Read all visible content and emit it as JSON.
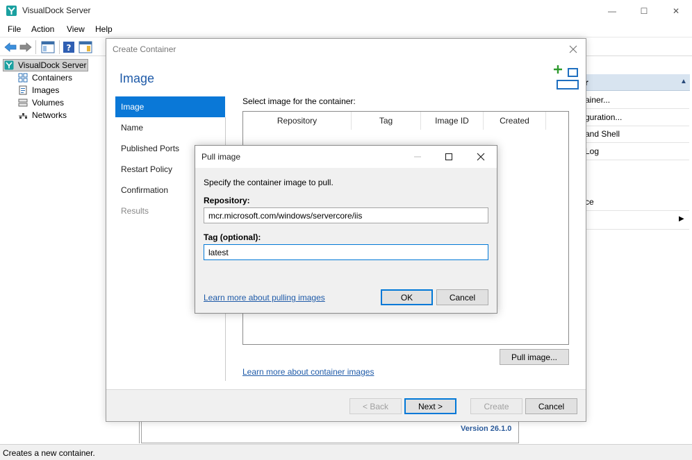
{
  "window": {
    "title": "VisualDock Server",
    "controls": {
      "minimize": "—",
      "maximize": "☐",
      "close": "✕"
    }
  },
  "menu": [
    "File",
    "Action",
    "View",
    "Help"
  ],
  "tree": {
    "root": "VisualDock Server",
    "items": [
      "Containers",
      "Images",
      "Volumes",
      "Networks"
    ]
  },
  "actions": {
    "header": "r",
    "items": [
      "ainer...",
      "guration...",
      "and Shell",
      "Log",
      "ce"
    ]
  },
  "status": "Creates a new container.",
  "version": "Version 26.1.0",
  "create_dialog": {
    "title": "Create Container",
    "heading": "Image",
    "steps": [
      "Image",
      "Name",
      "Published Ports",
      "Restart Policy",
      "Confirmation",
      "Results"
    ],
    "select_label": "Select image for the container:",
    "columns": [
      "Repository",
      "Tag",
      "Image ID",
      "Created"
    ],
    "pull_button": "Pull image...",
    "learn_link": "Learn more about container images",
    "footer": {
      "back": "< Back",
      "next": "Next >",
      "create": "Create",
      "cancel": "Cancel"
    }
  },
  "pull_dialog": {
    "title": "Pull image",
    "description": "Specify the container image to pull.",
    "repository_label": "Repository:",
    "repository_value": "mcr.microsoft.com/windows/servercore/iis",
    "tag_label": "Tag (optional):",
    "tag_value": "latest",
    "learn_link": "Learn more about pulling images",
    "ok": "OK",
    "cancel": "Cancel"
  },
  "colors": {
    "accent": "#0a78d7",
    "link": "#1e5aa8",
    "icon_green": "#2e9a2e"
  }
}
